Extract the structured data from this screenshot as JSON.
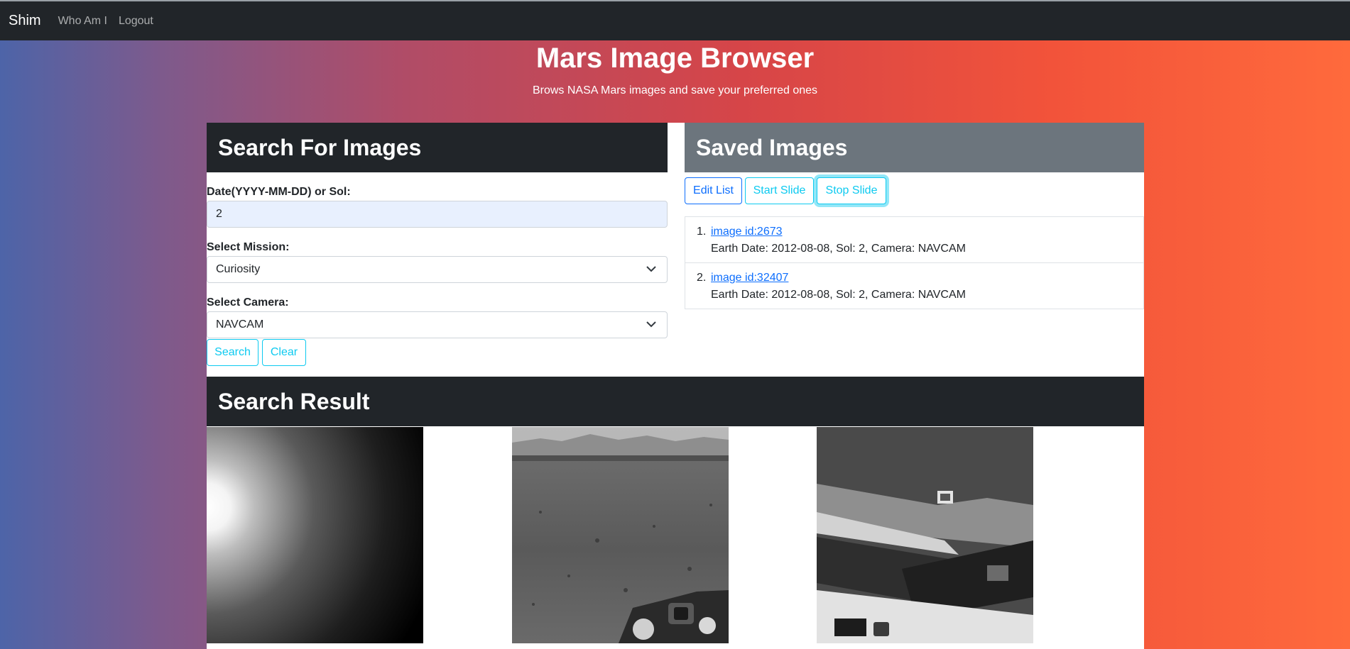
{
  "navbar": {
    "brand": "Shim",
    "links": [
      "Who Am I",
      "Logout"
    ]
  },
  "hero": {
    "title": "Mars Image Browser",
    "subtitle": "Brows NASA Mars images and save your preferred ones"
  },
  "search_panel": {
    "heading": "Search For Images",
    "date_label": "Date(YYYY-MM-DD) or Sol:",
    "date_value": "2",
    "mission_label": "Select Mission:",
    "mission_value": "Curiosity",
    "camera_label": "Select Camera:",
    "camera_value": "NAVCAM",
    "search_button": "Search",
    "clear_button": "Clear"
  },
  "saved_panel": {
    "heading": "Saved Images",
    "edit_button": "Edit List",
    "start_button": "Start Slide",
    "stop_button": "Stop Slide",
    "items": [
      {
        "number": "1.",
        "link": "image id:2673",
        "meta": "Earth Date: 2012-08-08, Sol: 2, Camera: NAVCAM"
      },
      {
        "number": "2.",
        "link": "image id:32407",
        "meta": "Earth Date: 2012-08-08, Sol: 2, Camera: NAVCAM"
      }
    ]
  },
  "results": {
    "heading": "Search Result"
  }
}
